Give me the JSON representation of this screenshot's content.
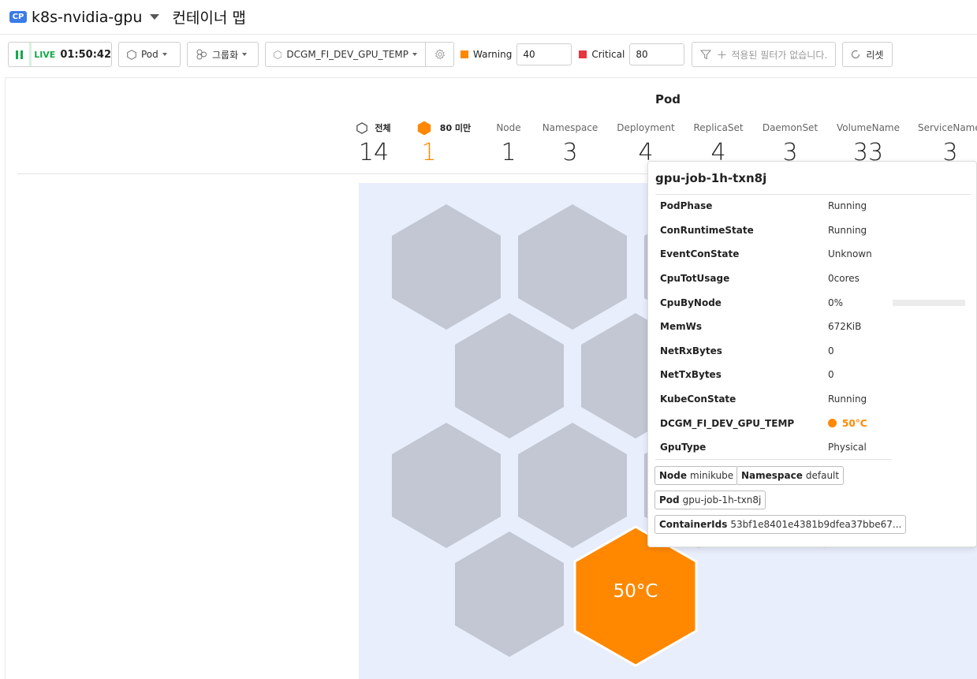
{
  "header": {
    "badge": "CP",
    "project": "k8s-nvidia-gpu",
    "title": "컨테이너 맵"
  },
  "toolbar": {
    "live_label": "LIVE",
    "live_time": "01:50:42",
    "object_type": "Pod",
    "grouping": "그룹화",
    "metric": "DCGM_FI_DEV_GPU_TEMP",
    "warning_label": "Warning",
    "warning_value": "40",
    "critical_label": "Critical",
    "critical_value": "80",
    "filter_placeholder": "적용된 필터가 없습니다.",
    "reset": "리셋",
    "colors": {
      "warning": "#ff8800",
      "critical": "#e8343f",
      "live": "#18a84c"
    }
  },
  "summary": {
    "title": "Pod",
    "stats": [
      {
        "label": "전체",
        "value": "14"
      },
      {
        "label": "80 미만",
        "value": "1"
      },
      {
        "label": "Node",
        "value": "1"
      },
      {
        "label": "Namespace",
        "value": "3"
      },
      {
        "label": "Deployment",
        "value": "4"
      },
      {
        "label": "ReplicaSet",
        "value": "4"
      },
      {
        "label": "DaemonSet",
        "value": "3"
      },
      {
        "label": "VolumeName",
        "value": "33"
      },
      {
        "label": "ServiceName",
        "value": "3"
      }
    ]
  },
  "hexmap": {
    "highlight_label": "50°C",
    "highlight_color": "#ff8800",
    "inactive_color": "#c2c7d3"
  },
  "tooltip": {
    "title": "gpu-job-1h-txn8j",
    "rows": [
      {
        "key": "PodPhase",
        "value": "Running"
      },
      {
        "key": "ConRuntimeState",
        "value": "Running"
      },
      {
        "key": "EventConState",
        "value": "Unknown"
      },
      {
        "key": "CpuTotUsage",
        "value": "0cores"
      },
      {
        "key": "CpuByNode",
        "value": "0%"
      },
      {
        "key": "MemWs",
        "value": "672KiB"
      },
      {
        "key": "NetRxBytes",
        "value": "0"
      },
      {
        "key": "NetTxBytes",
        "value": "0"
      },
      {
        "key": "KubeConState",
        "value": "Running"
      },
      {
        "key": "DCGM_FI_DEV_GPU_TEMP",
        "value": "50°C"
      },
      {
        "key": "GpuType",
        "value": "Physical"
      }
    ],
    "tags": [
      {
        "key": "Node",
        "value": "minikube"
      },
      {
        "key": "Namespace",
        "value": "default"
      },
      {
        "key": "Pod",
        "value": "gpu-job-1h-txn8j"
      },
      {
        "key": "ContainerIds",
        "value": "53bf1e8401e4381b9dfea37bbe67..."
      }
    ]
  }
}
